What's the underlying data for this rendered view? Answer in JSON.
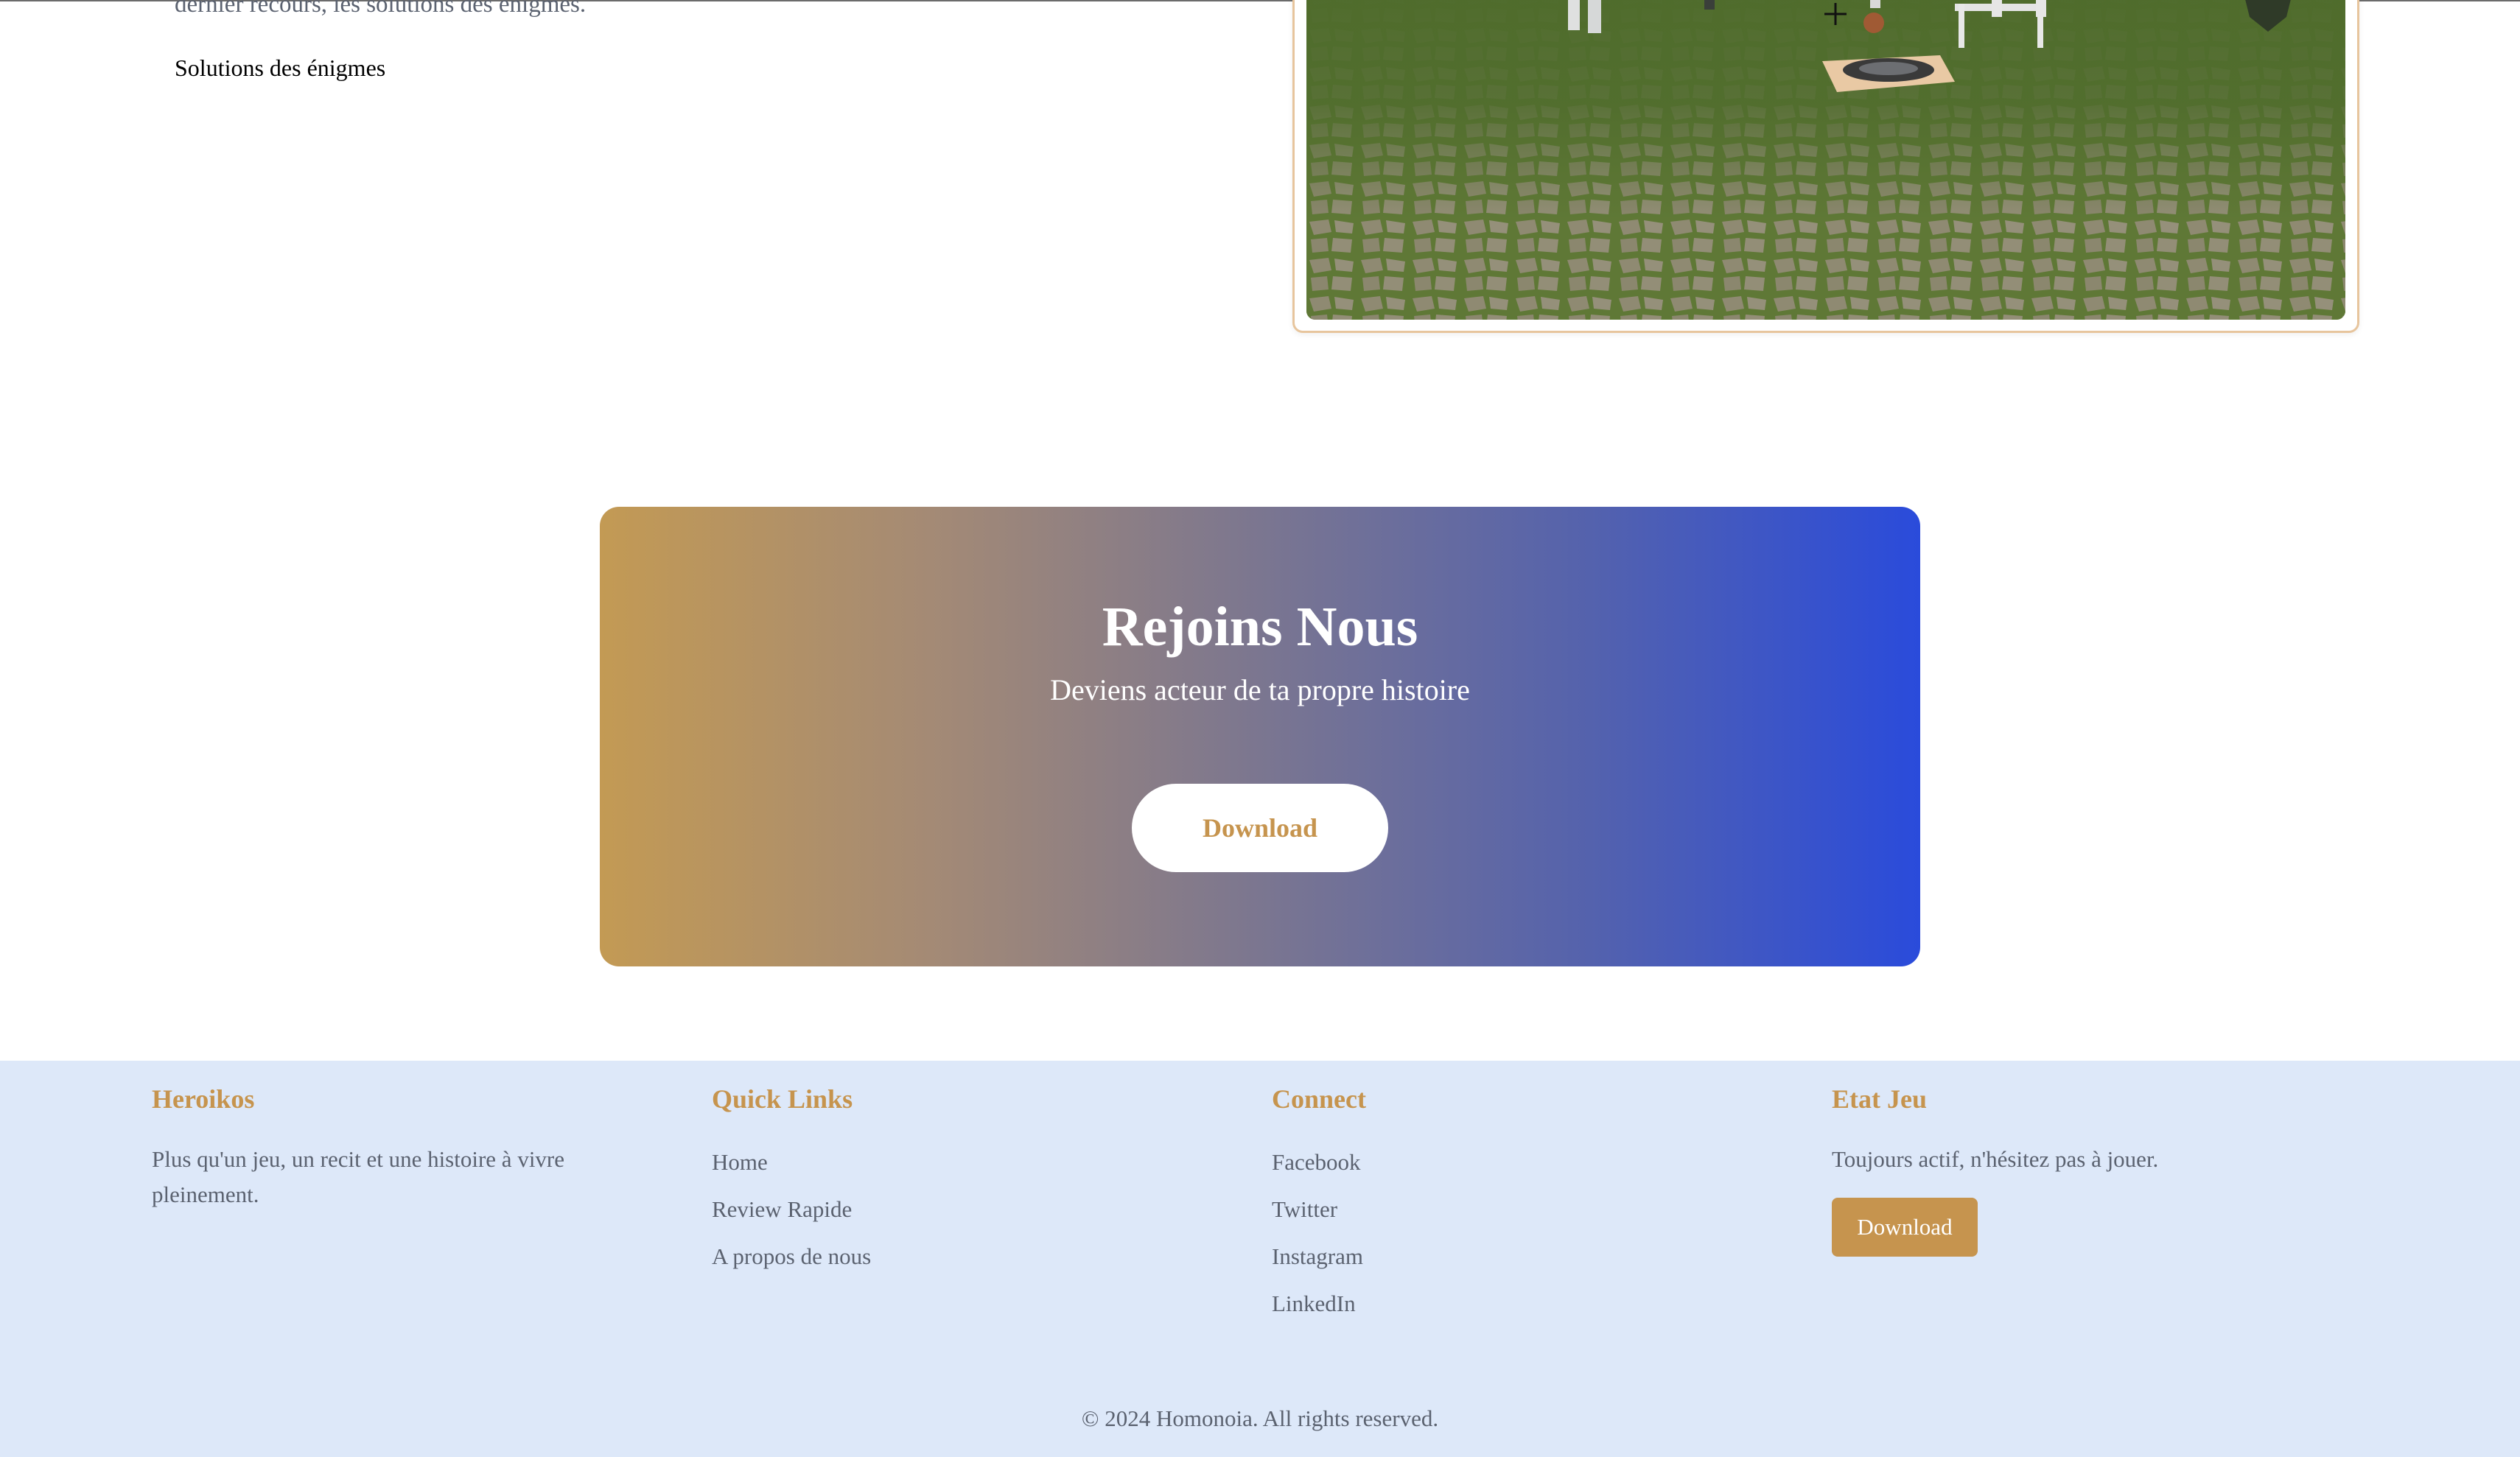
{
  "upper": {
    "paragraph_tail": "dernier recours, les solutions des énigmes.",
    "solutions_link": "Solutions des énigmes"
  },
  "cta": {
    "title": "Rejoins Nous",
    "subtitle": "Deviens acteur de ta propre histoire",
    "button": "Download"
  },
  "footer": {
    "brand": {
      "title": "Heroikos",
      "description": "Plus qu'un jeu, un recit et une histoire à vivre pleinement."
    },
    "quick_links": {
      "title": "Quick Links",
      "items": [
        "Home",
        "Review Rapide",
        "A propos de nous"
      ]
    },
    "connect": {
      "title": "Connect",
      "items": [
        "Facebook",
        "Twitter",
        "Instagram",
        "LinkedIn"
      ]
    },
    "status": {
      "title": "Etat Jeu",
      "description": "Toujours actif, n'hésitez pas à jouer.",
      "button": "Download"
    },
    "copyright": "© 2024 Homonoia. All rights reserved."
  },
  "colors": {
    "accent": "#c6944e",
    "footer_bg": "#dde8f9",
    "gradient_start": "#c39a54",
    "gradient_end": "#2a4bdb"
  }
}
